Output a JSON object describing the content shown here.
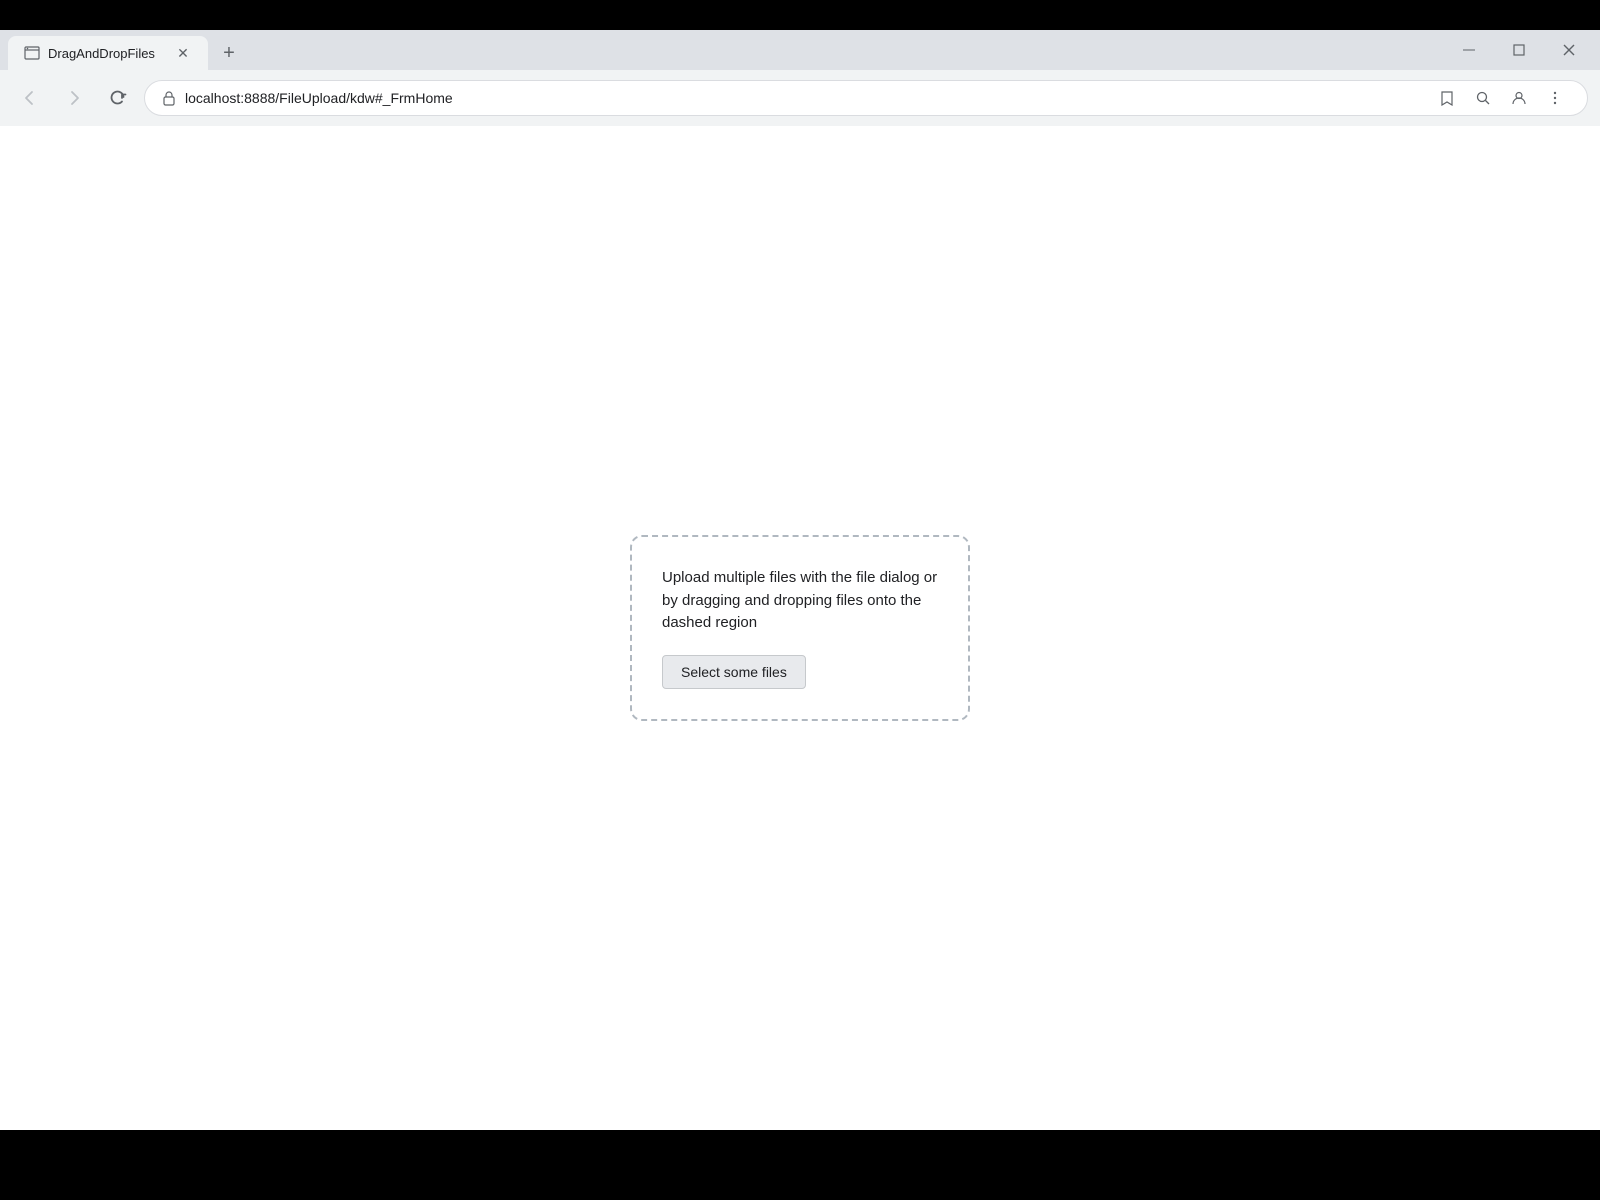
{
  "browser": {
    "tab": {
      "title": "DragAndDropFiles",
      "url": "localhost:8888/FileUpload/kdw#_FrmHome"
    },
    "nav": {
      "back_label": "‹",
      "forward_label": "›",
      "refresh_label": "↻"
    },
    "window_controls": {
      "minimize": "—",
      "maximize": "❐",
      "close": "✕"
    },
    "new_tab_label": "+"
  },
  "page": {
    "dropzone": {
      "instruction_text": "Upload multiple files with the file dialog or by dragging and dropping files onto the dashed region",
      "button_label": "Select some files"
    }
  }
}
